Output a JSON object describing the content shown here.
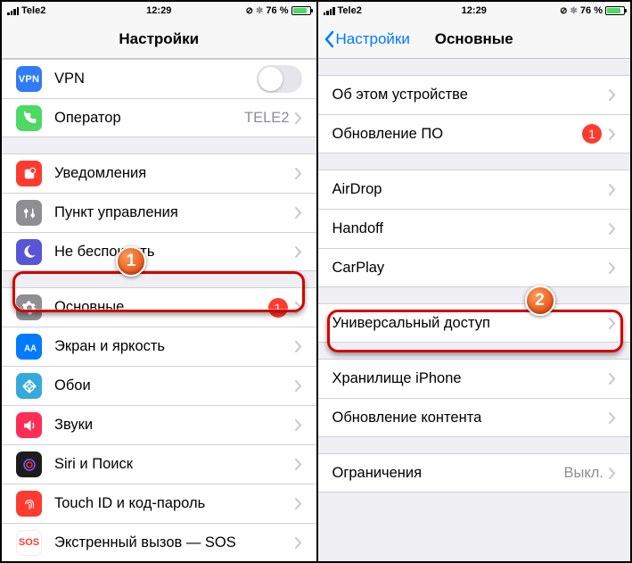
{
  "status_bar": {
    "carrier": "Tele2",
    "time": "12:29",
    "battery_pct": "76 %",
    "orientation_lock": "⊘",
    "bluetooth": "✱"
  },
  "left": {
    "nav_title": "Настройки",
    "rows": {
      "vpn": "VPN",
      "carrier": "Оператор",
      "carrier_value": "TELE2",
      "notifications": "Уведомления",
      "control_center": "Пункт управления",
      "dnd": "Не беспокоить",
      "general": "Основные",
      "general_badge": "1",
      "display": "Экран и яркость",
      "wallpaper": "Обои",
      "sounds": "Звуки",
      "siri": "Siri и Поиск",
      "touchid": "Touch ID и код-пароль",
      "sos": "Экстренный вызов — SOS",
      "sos_icon_text": "SOS"
    }
  },
  "right": {
    "nav_back": "Настройки",
    "nav_title": "Основные",
    "rows": {
      "about": "Об этом устройстве",
      "update": "Обновление ПО",
      "update_badge": "1",
      "airdrop": "AirDrop",
      "handoff": "Handoff",
      "carplay": "CarPlay",
      "accessibility": "Универсальный доступ",
      "storage": "Хранилище iPhone",
      "bgrefresh": "Обновление контента",
      "restrictions": "Ограничения",
      "restrictions_value": "Выкл."
    }
  },
  "annotations": {
    "marker1": "1",
    "marker2": "2"
  }
}
